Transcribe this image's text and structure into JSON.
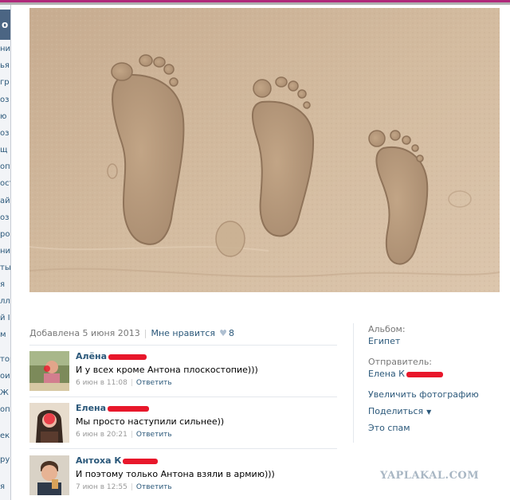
{
  "left_strip": {
    "header": "о",
    "fragments": [
      "ни",
      "ья",
      "гр",
      "оз",
      "ю",
      "оз",
      "щ",
      "оп",
      "ост",
      "ай",
      "оз",
      "ро",
      "ни",
      "ты",
      "я",
      "лл",
      "й I",
      "м",
      "тор",
      "ои",
      "Ж",
      "оп",
      "ек",
      "ру",
      "я"
    ]
  },
  "photo": {
    "alt": "footprints-in-sand"
  },
  "meta": {
    "added": "Добавлена 5 июня 2013",
    "like": "Мне нравится",
    "like_count": "8"
  },
  "comments": [
    {
      "name": "Алёна",
      "text": "И у всех кроме Антона плоскостопие)))",
      "time": "6 июн в 11:08",
      "reply": "Ответить"
    },
    {
      "name": "Елена",
      "text": "Мы просто наступили сильнее))",
      "time": "6 июн в 20:21",
      "reply": "Ответить"
    },
    {
      "name": "Антоха К",
      "text": "И поэтому только Антона взяли в армию)))",
      "time": "7 июн в 12:55",
      "reply": "Ответить"
    }
  ],
  "sidebar": {
    "album_label": "Альбом:",
    "album_value": "Египет",
    "sender_label": "Отправитель:",
    "sender_value": "Елена К",
    "enlarge": "Увеличить фотографию",
    "share": "Поделиться",
    "spam": "Это спам"
  },
  "watermark": "YAPLAKAL.COM",
  "colors": {
    "link": "#2b587a",
    "redaction": "#e8172b",
    "accent_bar": "#b0287a"
  }
}
